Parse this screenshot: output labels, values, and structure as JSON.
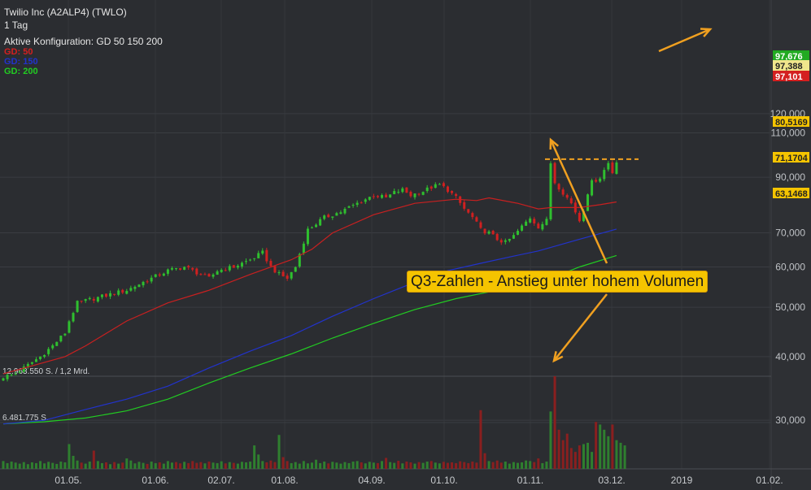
{
  "header": {
    "title": "Twilio Inc (A2ALP4) (TWLO)",
    "interval": "1 Tag",
    "config": "Aktive Konfiguration: GD 50 150 200"
  },
  "legend": [
    {
      "label": "GD: 50",
      "color": "#d42020"
    },
    {
      "label": "GD: 150",
      "color": "#2233cc"
    },
    {
      "label": "GD: 200",
      "color": "#22cc22"
    }
  ],
  "annotation": {
    "text": "Q3-Zahlen - Anstieg unter hohem Volumen"
  },
  "chart_data": {
    "type": "candlestick",
    "x_tick_labels": [
      "01.05.",
      "01.06.",
      "02.07.",
      "01.08.",
      "04.09.",
      "01.10.",
      "01.11.",
      "03.12.",
      "2019",
      "01.02."
    ],
    "y_ticks": [
      30000,
      40000,
      50000,
      60000,
      70000,
      90000,
      110000,
      120000
    ],
    "y_tick_labels": [
      "30,000",
      "40,000",
      "50,000",
      "60,000",
      "70,000",
      "90,000",
      "110,000",
      "120,000"
    ],
    "price_scale": "log",
    "price_badges": [
      {
        "label": "97,676",
        "value": 97676,
        "bg": "#22aa22",
        "fg": "#ffffff"
      },
      {
        "label": "97,388",
        "value": 97388,
        "bg": "#f0e68c",
        "fg": "#222222"
      },
      {
        "label": "97,101",
        "value": 97101,
        "bg": "#d42020",
        "fg": "#ffffff"
      },
      {
        "label": "80,5169",
        "value": 80516.9,
        "bg": "#f5c400",
        "fg": "#222222"
      },
      {
        "label": "71,1704",
        "value": 71170.4,
        "bg": "#f5c400",
        "fg": "#222222"
      },
      {
        "label": "63,1468",
        "value": 63146.8,
        "bg": "#f5c400",
        "fg": "#222222"
      }
    ],
    "volume_labels": [
      "12.963.550 S. / 1,2 Mrd.",
      "6.481.775 S."
    ],
    "resistance_level": 97676,
    "price_path": [
      [
        0,
        36.5
      ],
      [
        3,
        37
      ],
      [
        6,
        38.5
      ],
      [
        9,
        40
      ],
      [
        12,
        42
      ],
      [
        15,
        44.5
      ],
      [
        16,
        47
      ],
      [
        18,
        51
      ],
      [
        22,
        52
      ],
      [
        26,
        53
      ],
      [
        30,
        54
      ],
      [
        33,
        55.5
      ],
      [
        36,
        57
      ],
      [
        40,
        59
      ],
      [
        44,
        60
      ],
      [
        48,
        58
      ],
      [
        50,
        57
      ],
      [
        52,
        59
      ],
      [
        56,
        60
      ],
      [
        60,
        62
      ],
      [
        63,
        64
      ],
      [
        65,
        60
      ],
      [
        67,
        58
      ],
      [
        69,
        57
      ],
      [
        71,
        60
      ],
      [
        74,
        71
      ],
      [
        76,
        73
      ],
      [
        78,
        75
      ],
      [
        82,
        77
      ],
      [
        86,
        80
      ],
      [
        90,
        83
      ],
      [
        93,
        82
      ],
      [
        95,
        84
      ],
      [
        97,
        85
      ],
      [
        99,
        83
      ],
      [
        102,
        84.5
      ],
      [
        104,
        86
      ],
      [
        106,
        87
      ],
      [
        108,
        85
      ],
      [
        110,
        82
      ],
      [
        112,
        78
      ],
      [
        114,
        75
      ],
      [
        116,
        71
      ],
      [
        118,
        70
      ],
      [
        120,
        68
      ],
      [
        122,
        67
      ],
      [
        124,
        69
      ],
      [
        126,
        72
      ],
      [
        128,
        75
      ],
      [
        130,
        72
      ],
      [
        132,
        74
      ],
      [
        133,
        96
      ],
      [
        134,
        88
      ],
      [
        136,
        84
      ],
      [
        138,
        80
      ],
      [
        140,
        74
      ],
      [
        141,
        78
      ],
      [
        142,
        84
      ],
      [
        143,
        88
      ],
      [
        145,
        90
      ],
      [
        146,
        93
      ],
      [
        147,
        96
      ],
      [
        148,
        92
      ],
      [
        149,
        97
      ]
    ],
    "sma_points": {
      "gd50": [
        [
          0,
          37
        ],
        [
          15,
          40
        ],
        [
          20,
          42
        ],
        [
          30,
          47
        ],
        [
          40,
          51
        ],
        [
          50,
          54
        ],
        [
          60,
          58
        ],
        [
          70,
          62
        ],
        [
          75,
          65
        ],
        [
          80,
          70
        ],
        [
          90,
          76
        ],
        [
          100,
          80
        ],
        [
          110,
          81.5
        ],
        [
          115,
          81
        ],
        [
          118,
          82
        ],
        [
          125,
          80
        ],
        [
          130,
          78
        ],
        [
          133,
          78.5
        ],
        [
          140,
          78.5
        ],
        [
          145,
          79.5
        ],
        [
          149,
          80.5
        ]
      ],
      "gd150": [
        [
          0,
          29.5
        ],
        [
          10,
          30
        ],
        [
          20,
          31.5
        ],
        [
          30,
          33
        ],
        [
          40,
          35
        ],
        [
          50,
          38
        ],
        [
          60,
          41
        ],
        [
          70,
          44
        ],
        [
          80,
          48
        ],
        [
          90,
          52
        ],
        [
          100,
          56
        ],
        [
          108,
          59
        ],
        [
          116,
          61
        ],
        [
          124,
          63
        ],
        [
          130,
          64.5
        ],
        [
          140,
          68
        ],
        [
          149,
          71.2
        ]
      ],
      "gd200": [
        [
          0,
          29.5
        ],
        [
          10,
          29.8
        ],
        [
          20,
          30.3
        ],
        [
          30,
          31.3
        ],
        [
          40,
          33
        ],
        [
          50,
          35.5
        ],
        [
          60,
          38
        ],
        [
          70,
          40.5
        ],
        [
          80,
          43.5
        ],
        [
          90,
          46.5
        ],
        [
          100,
          49.5
        ],
        [
          110,
          52
        ],
        [
          120,
          54
        ],
        [
          125,
          55.3
        ],
        [
          133,
          57
        ],
        [
          140,
          60
        ],
        [
          149,
          63.2
        ]
      ]
    },
    "volume": [
      3.0,
      2.2,
      2.8,
      2.4,
      2.0,
      2.6,
      1.8,
      2.5,
      2.2,
      3.0,
      2.1,
      2.7,
      2.3,
      1.9,
      2.8,
      2.5,
      9.5,
      5.0,
      3.2,
      2.4,
      2.0,
      2.8,
      7.0,
      3.0,
      2.2,
      2.5,
      1.8,
      2.6,
      2.0,
      2.4,
      4.0,
      3.2,
      2.1,
      2.7,
      2.3,
      1.9,
      2.8,
      2.2,
      2.5,
      2.0,
      3.0,
      2.4,
      2.6,
      2.1,
      2.7,
      2.2,
      3.0,
      2.3,
      2.6,
      2.1,
      2.8,
      2.4,
      2.2,
      2.9,
      2.1,
      2.6,
      2.3,
      2.0,
      2.7,
      2.5,
      2.8,
      9.0,
      5.5,
      3.0,
      2.5,
      3.2,
      2.6,
      13.0,
      4.5,
      3.0,
      2.2,
      2.6,
      2.0,
      3.0,
      2.1,
      2.4,
      3.5,
      2.2,
      2.8,
      2.1,
      2.7,
      2.4,
      2.0,
      2.6,
      2.2,
      2.8,
      3.0,
      2.5,
      2.1,
      2.7,
      2.4,
      2.2,
      3.0,
      4.2,
      2.6,
      2.3,
      3.1,
      2.1,
      2.8,
      2.5,
      2.0,
      2.6,
      2.3,
      2.8,
      3.0,
      2.4,
      2.1,
      2.7,
      2.3,
      2.5,
      2.2,
      2.9,
      2.6,
      2.2,
      2.8,
      2.4,
      22.5,
      6.0,
      3.0,
      2.6,
      3.2,
      2.4,
      2.8,
      2.0,
      2.6,
      2.3,
      2.5,
      3.2,
      3.0,
      2.6,
      4.0,
      2.2,
      2.8,
      22.0,
      35.5,
      15.0,
      11.0,
      13.5,
      8.0,
      6.5,
      9.0,
      9.5,
      10.0,
      6.5,
      18.0,
      17.0,
      15.0,
      12.5,
      17.0,
      11.0,
      10.0,
      9.0
    ]
  }
}
